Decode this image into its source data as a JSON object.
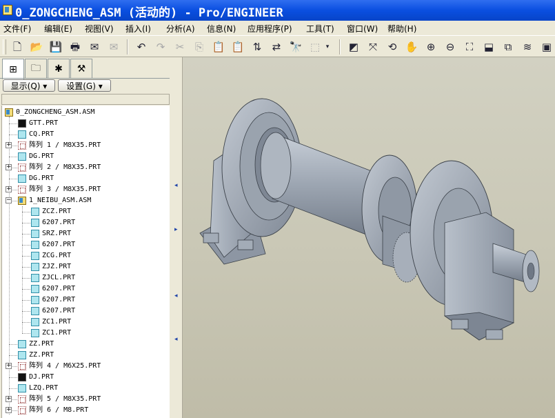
{
  "window": {
    "title": "0_ZONGCHENG_ASM (活动的) - Pro/ENGINEER"
  },
  "menu": [
    "文件(F)",
    "编辑(E)",
    "视图(V)",
    "插入(I)",
    "分析(A)",
    "信息(N)",
    "应用程序(P)",
    "工具(T)",
    "窗口(W)",
    "帮助(H)"
  ],
  "panel": {
    "display_label": "显示(Q) ▾",
    "settings_label": "设置(G) ▾"
  },
  "tree": {
    "root": "0_ZONGCHENG_ASM.ASM",
    "items": [
      {
        "label": "GTT.PRT",
        "icon": "black-part-icon"
      },
      {
        "label": "CQ.PRT",
        "icon": "part-icon"
      },
      {
        "label": "阵列 1 / M8X35.PRT",
        "icon": "pattern-icon"
      },
      {
        "label": "DG.PRT",
        "icon": "part-icon"
      },
      {
        "label": "阵列 2 / M8X35.PRT",
        "icon": "pattern-icon"
      },
      {
        "label": "DG.PRT",
        "icon": "part-icon"
      },
      {
        "label": "阵列 3 / M8X35.PRT",
        "icon": "pattern-icon"
      },
      {
        "label": "1_NEIBU_ASM.ASM",
        "icon": "assembly-icon"
      },
      {
        "label": "ZCZ.PRT",
        "icon": "part-icon"
      },
      {
        "label": "6207.PRT",
        "icon": "part-icon"
      },
      {
        "label": "SRZ.PRT",
        "icon": "part-icon"
      },
      {
        "label": "6207.PRT",
        "icon": "part-icon"
      },
      {
        "label": "ZCG.PRT",
        "icon": "part-icon"
      },
      {
        "label": "ZJZ.PRT",
        "icon": "part-icon"
      },
      {
        "label": "ZJCL.PRT",
        "icon": "part-icon"
      },
      {
        "label": "6207.PRT",
        "icon": "part-icon"
      },
      {
        "label": "6207.PRT",
        "icon": "part-icon"
      },
      {
        "label": "6207.PRT",
        "icon": "part-icon"
      },
      {
        "label": "ZC1.PRT",
        "icon": "part-icon"
      },
      {
        "label": "ZC1.PRT",
        "icon": "part-icon"
      },
      {
        "label": "ZZ.PRT",
        "icon": "part-icon"
      },
      {
        "label": "ZZ.PRT",
        "icon": "part-icon"
      },
      {
        "label": "阵列 4 / M6X25.PRT",
        "icon": "pattern-icon"
      },
      {
        "label": "DJ.PRT",
        "icon": "black-part-icon"
      },
      {
        "label": "LZQ.PRT",
        "icon": "part-icon"
      },
      {
        "label": "阵列 5 / M8X35.PRT",
        "icon": "pattern-icon"
      },
      {
        "label": "阵列 6 / M8.PRT",
        "icon": "pattern-icon"
      }
    ]
  },
  "colors": {
    "titlebar": "#0a4fe0",
    "model": "#aab2bd",
    "viewport_bg": "#c9c7b5"
  }
}
